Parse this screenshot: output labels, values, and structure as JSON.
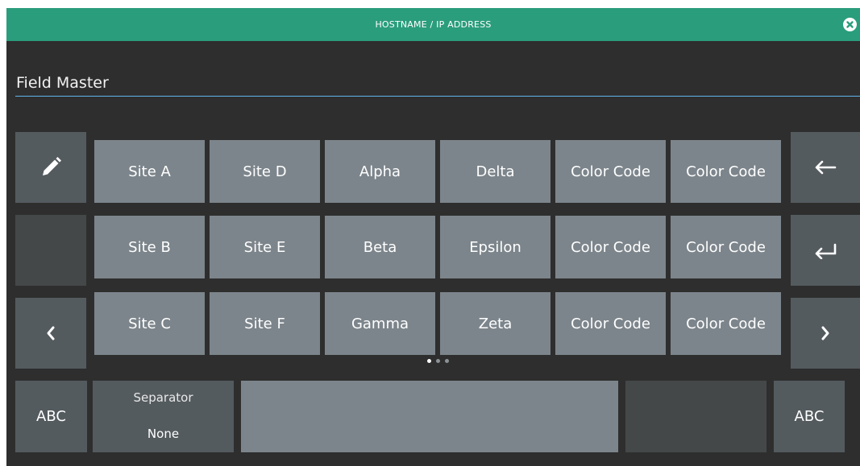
{
  "header": {
    "title": "HOSTNAME / IP ADDRESS",
    "close_icon": "close-circle-icon",
    "accent_color": "#2a9d7c"
  },
  "input": {
    "value": "Field Master",
    "underline_color": "#5fb7ea"
  },
  "left_keys": {
    "edit_icon": "pencil-icon",
    "prev_icon": "chevron-left-icon"
  },
  "right_keys": {
    "backspace_icon": "arrow-left-icon",
    "enter_icon": "return-arrow-icon",
    "next_icon": "chevron-right-icon"
  },
  "grid": {
    "rows": [
      [
        "Site A",
        "Site D",
        "Alpha",
        "Delta",
        "Color Code",
        "Color Code"
      ],
      [
        "Site B",
        "Site E",
        "Beta",
        "Epsilon",
        "Color Code",
        "Color Code"
      ],
      [
        "Site C",
        "Site F",
        "Gamma",
        "Zeta",
        "Color Code",
        "Color Code"
      ]
    ]
  },
  "pager": {
    "pages": 3,
    "current": 1
  },
  "bottom": {
    "abc_left": "ABC",
    "separator_label": "Separator",
    "separator_value": "None",
    "abc_right": "ABC"
  }
}
